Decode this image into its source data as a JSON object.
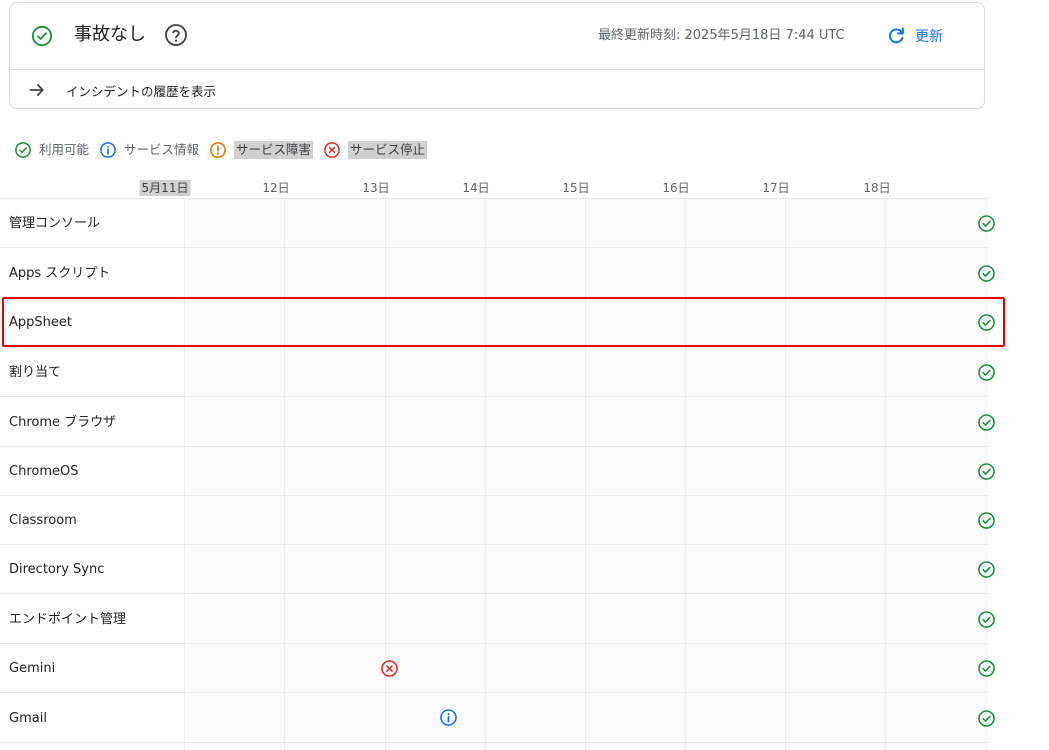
{
  "status": {
    "title": "事故なし",
    "last_updated": "最終更新時刻: 2025年5月18日 7:44 UTC",
    "refresh_label": "更新",
    "history_label": "インシデントの履歴を表示"
  },
  "legend": [
    {
      "label": "利用可能",
      "icon": "check-circle-icon",
      "color": "#1e8e3e"
    },
    {
      "label": "サービス情報",
      "icon": "info-circle-icon",
      "color": "#1a73e8"
    },
    {
      "label": "サービス障害",
      "icon": "exclamation-circle-icon",
      "color": "#e37400"
    },
    {
      "label": "サービス停止",
      "icon": "x-circle-icon",
      "color": "#d93025"
    }
  ],
  "days": [
    "5月11日",
    "12日",
    "13日",
    "14日",
    "15日",
    "16日",
    "17日",
    "18日"
  ],
  "services": [
    {
      "name": "管理コンソール",
      "status": "available"
    },
    {
      "name": "Apps スクリプト",
      "status": "available"
    },
    {
      "name": "AppSheet",
      "status": "available"
    },
    {
      "name": "割り当て",
      "status": "available"
    },
    {
      "name": "Chrome ブラウザ",
      "status": "available"
    },
    {
      "name": "ChromeOS",
      "status": "available"
    },
    {
      "name": "Classroom",
      "status": "available"
    },
    {
      "name": "Directory Sync",
      "status": "available"
    },
    {
      "name": "エンドポイント管理",
      "status": "available"
    },
    {
      "name": "Gemini",
      "status": "available",
      "incident": {
        "type": "outage",
        "date": "13日"
      }
    },
    {
      "name": "Gmail",
      "status": "available",
      "incident": {
        "type": "info",
        "date": "14日"
      }
    }
  ],
  "colors": {
    "available": "#1e8e3e",
    "info": "#1a73e8",
    "disruption": "#e37400",
    "outage": "#d93025",
    "highlight": "#e00000"
  }
}
